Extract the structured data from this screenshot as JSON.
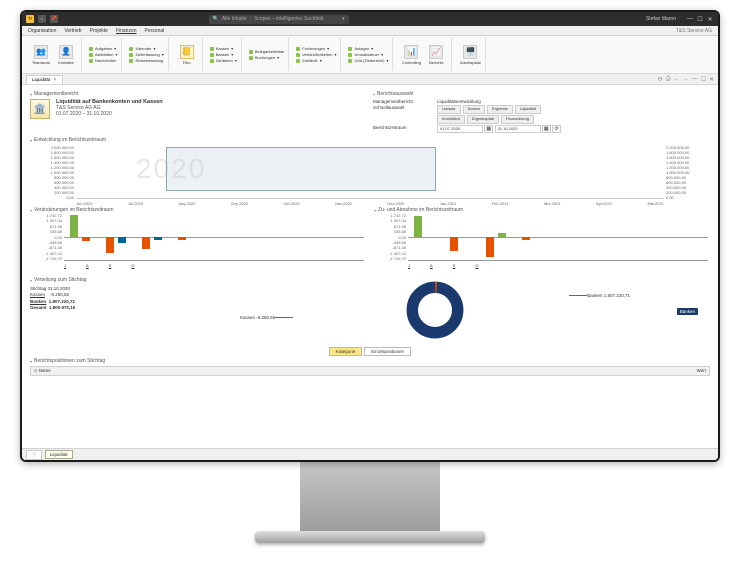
{
  "titlebar": {
    "search_prefix": "Alle Inhalte",
    "search_placeholder": "Scopes – intelligentes Suchfeld",
    "user": "Stefan Maron"
  },
  "menu": {
    "items": [
      "Organisation",
      "Vertrieb",
      "Projekte",
      "Finanzen",
      "Personal"
    ],
    "active": "Finanzen",
    "company": "T&S Service AG"
  },
  "ribbon": {
    "big": [
      {
        "label": "Teamwork"
      },
      {
        "label": "Kontakte"
      }
    ],
    "col1": [
      {
        "label": "Aufgaben"
      },
      {
        "label": "Aktivitäten"
      },
      {
        "label": "Nachrichten"
      }
    ],
    "col2": [
      {
        "label": "Kalender"
      },
      {
        "label": "Zeiterfassung"
      },
      {
        "label": "Reiseerfassung"
      }
    ],
    "big2": [
      {
        "label": "Fibu"
      }
    ],
    "col3": [
      {
        "label": "Kassen"
      },
      {
        "label": "Banken"
      },
      {
        "label": "Zahllisten"
      }
    ],
    "col4": [
      {
        "label": "Belegarbeitsliste"
      },
      {
        "label": "Buchungen"
      }
    ],
    "col5": [
      {
        "label": "Forderungen"
      },
      {
        "label": "Verbindlichkeiten"
      },
      {
        "label": "Zahläufe"
      }
    ],
    "col6": [
      {
        "label": "Anlagen"
      },
      {
        "label": "Umsatzsteuer"
      },
      {
        "label": "UVA (Österreich)"
      }
    ],
    "big3": [
      {
        "label": "Controlling"
      },
      {
        "label": "Berichte"
      },
      {
        "label": "Arbeitsplatz"
      }
    ]
  },
  "tabs": {
    "main": "Liquidität"
  },
  "report": {
    "section": "Managementbericht",
    "title": "Liquidität auf Bankenkonten und Kassen",
    "company": "T&S Service AG AG",
    "daterange": "01.07.2020 – 31.10.2020",
    "selection": {
      "heading": "Berichtsauswahl",
      "row1_label": "Managementbericht",
      "row1_val": "Liquiditätsentwicklung",
      "row2_label": "Schnellauswahl",
      "btns1": [
        "Umsatz",
        "Kosten",
        "Ergebnis",
        "Liquidität"
      ],
      "btns2": [
        "Investition",
        "Eigenkapital",
        "Finanzierung"
      ],
      "row3_label": "Berichtszeitraum",
      "from": "01.07.2020",
      "to": "31.10.2020"
    }
  },
  "timeline": {
    "title": "Entwicklung im Berichtszeitraum",
    "watermark": "2020",
    "ylabels": [
      "2.000.000,00",
      "1.800.000,00",
      "1.600.000,00",
      "1.400.000,00",
      "1.200.000,00",
      "1.000.000,00",
      "800.000,00",
      "600.000,00",
      "400.000,00",
      "200.000,00",
      "0,00"
    ],
    "xlabels": [
      "Jun.2020",
      "Jul.2020",
      "Aug.2020",
      "Sep.2020",
      "Okt.2020",
      "Nov.2020",
      "Dez.2020",
      "Jan.2021",
      "Feb.2021",
      "Mrz.2021",
      "Apr.2021",
      "Mai.2021"
    ]
  },
  "changes": {
    "left_title": "Veränderungen im Berichtszeitraum",
    "right_title": "Zu- und Abnahme im Berichtszeitraum",
    "ylabels": [
      "1.742,72",
      "1.307,04",
      "871,36",
      "435,68",
      "0,00",
      "-435,68",
      "-871,36",
      "-1.307,04",
      "-1.742,72"
    ],
    "xcats": [
      "J",
      "A",
      "S",
      "O"
    ]
  },
  "summary": {
    "title": "Verteilung zum Stichtag",
    "line1_label": "Stichtag",
    "line1_val": "31.10.2020",
    "line2_label": "Kassen",
    "line2_val": "-6.250,55",
    "line3_label": "Banken",
    "line3_val": "1.807.220,71",
    "line4_label": "Gesamt",
    "line4_val": "1.800.970,16"
  },
  "donut": {
    "label_banken": "Banken 1.807.220,71",
    "label_kassen": "Kassen -6.250,55",
    "badge": "Banken"
  },
  "viewbtns": {
    "a": "Kategorie",
    "b": "Einzelpositionen"
  },
  "table": {
    "title": "Berichtspositionen zum Stichtag",
    "col1": "Name",
    "col2": "Wert"
  },
  "bottomtabs": {
    "a": "",
    "b": "Liquidität"
  },
  "chart_data": [
    {
      "type": "area",
      "title": "Entwicklung im Berichtszeitraum",
      "x": [
        "Jun.2020",
        "Jul.2020",
        "Aug.2020",
        "Sep.2020",
        "Okt.2020",
        "Nov.2020",
        "Dez.2020",
        "Jan.2021",
        "Feb.2021",
        "Mrz.2021",
        "Apr.2021",
        "Mai.2021"
      ],
      "ylim": [
        0,
        2000000
      ]
    },
    {
      "type": "bar",
      "title": "Veränderungen im Berichtszeitraum",
      "categories": [
        "J",
        "A",
        "S",
        "O"
      ],
      "series": [
        {
          "name": "inc",
          "values": [
            1740,
            0,
            0,
            0
          ],
          "color": "#7cb342"
        },
        {
          "name": "dec",
          "values": [
            0,
            -1200,
            -900,
            -250
          ],
          "color": "#e65100"
        },
        {
          "name": "net",
          "values": [
            0,
            -400,
            -200,
            0
          ],
          "color": "#006699"
        }
      ],
      "ylim": [
        -1742.72,
        1742.72
      ]
    },
    {
      "type": "bar",
      "title": "Zu- und Abnahme im Berichtszeitraum",
      "categories": [
        "J",
        "A",
        "S",
        "O"
      ],
      "series": [
        {
          "name": "inc",
          "values": [
            1700,
            0,
            300,
            0
          ],
          "color": "#7cb342"
        },
        {
          "name": "dec",
          "values": [
            0,
            -1100,
            -1600,
            -200
          ],
          "color": "#e65100"
        }
      ],
      "ylim": [
        -1742.72,
        1742.72
      ]
    },
    {
      "type": "pie",
      "title": "Verteilung zum Stichtag",
      "slices": [
        {
          "name": "Banken",
          "value": 1807220.71,
          "color": "#1a3a6e"
        },
        {
          "name": "Kassen",
          "value": -6250.55,
          "color": "#e65100"
        }
      ]
    }
  ]
}
